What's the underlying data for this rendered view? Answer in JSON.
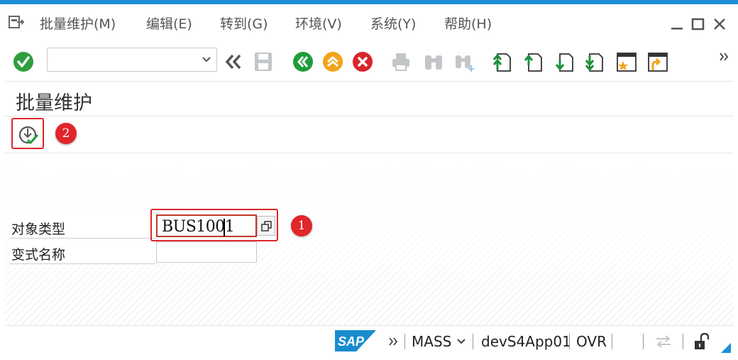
{
  "menu": {
    "items": [
      {
        "label": "批量维护(M)"
      },
      {
        "label": "编辑(E)"
      },
      {
        "label": "转到(G)"
      },
      {
        "label": "环境(V)"
      },
      {
        "label": "系统(Y)"
      },
      {
        "label": "帮助(H)"
      }
    ],
    "glyph": "menu-exit-icon"
  },
  "window_controls": [
    "minimize-icon",
    "maximize-icon",
    "close-icon"
  ],
  "toolbar": {
    "command_field_value": "",
    "icons": [
      "enter-check-icon",
      "command-field-dropdown-icon",
      "collapse-toolbar-icon",
      "save-icon",
      "back-icon",
      "exit-icon",
      "cancel-icon",
      "print-icon",
      "find-icon",
      "find-next-icon",
      "first-page-icon",
      "previous-page-icon",
      "next-page-icon",
      "last-page-icon",
      "create-session-icon",
      "generate-shortcut-icon",
      "more-icon"
    ],
    "colors": {
      "check_green": "#2e9e3e",
      "back_green": "#1f9c3b",
      "exit_orange": "#f3a31a",
      "cancel_red": "#d9262b",
      "disabled_gray": "#c3c6c9",
      "arrow_green": "#1f8f3a"
    }
  },
  "page": {
    "title": "批量维护"
  },
  "apptoolbar": {
    "execute_icon": "execute-icon",
    "badge_1": "1",
    "badge_2": "2"
  },
  "form": {
    "object_type_label": "对象类型",
    "object_type_value": "BUS1001",
    "variant_label": "变式名称",
    "variant_value": ""
  },
  "status": {
    "logo": "SAP",
    "expand_icon": "status-expand-icon",
    "transaction": "MASS",
    "server": "devS4App01",
    "mode": "OVR",
    "icons": [
      "transfer-icon",
      "unlock-icon"
    ]
  },
  "colors": {
    "frame_blue": "#1c8fd6",
    "highlight_red": "#e0262b",
    "sap_blue": "#1a8ccf"
  }
}
